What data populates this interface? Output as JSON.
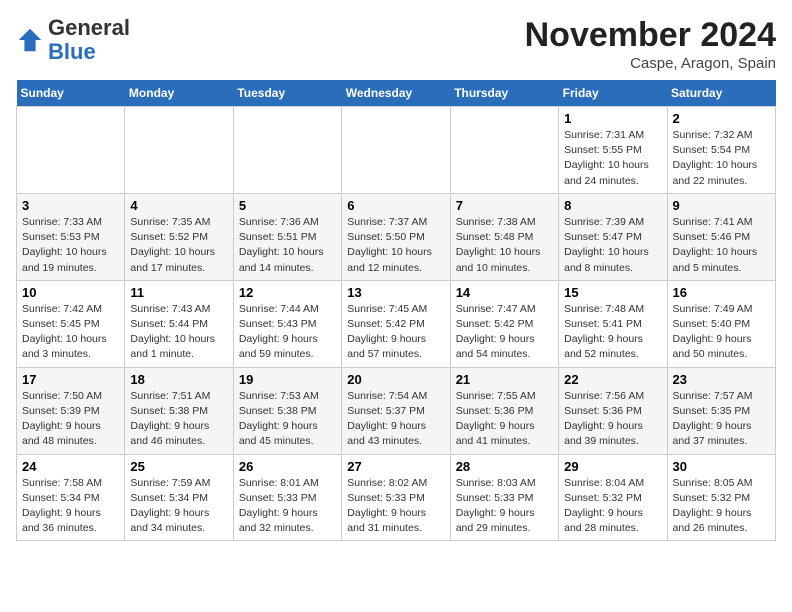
{
  "header": {
    "logo": {
      "general": "General",
      "blue": "Blue"
    },
    "title": "November 2024",
    "location": "Caspe, Aragon, Spain"
  },
  "weekdays": [
    "Sunday",
    "Monday",
    "Tuesday",
    "Wednesday",
    "Thursday",
    "Friday",
    "Saturday"
  ],
  "weeks": [
    [
      {
        "day": "",
        "info": ""
      },
      {
        "day": "",
        "info": ""
      },
      {
        "day": "",
        "info": ""
      },
      {
        "day": "",
        "info": ""
      },
      {
        "day": "",
        "info": ""
      },
      {
        "day": "1",
        "info": "Sunrise: 7:31 AM\nSunset: 5:55 PM\nDaylight: 10 hours\nand 24 minutes."
      },
      {
        "day": "2",
        "info": "Sunrise: 7:32 AM\nSunset: 5:54 PM\nDaylight: 10 hours\nand 22 minutes."
      }
    ],
    [
      {
        "day": "3",
        "info": "Sunrise: 7:33 AM\nSunset: 5:53 PM\nDaylight: 10 hours\nand 19 minutes."
      },
      {
        "day": "4",
        "info": "Sunrise: 7:35 AM\nSunset: 5:52 PM\nDaylight: 10 hours\nand 17 minutes."
      },
      {
        "day": "5",
        "info": "Sunrise: 7:36 AM\nSunset: 5:51 PM\nDaylight: 10 hours\nand 14 minutes."
      },
      {
        "day": "6",
        "info": "Sunrise: 7:37 AM\nSunset: 5:50 PM\nDaylight: 10 hours\nand 12 minutes."
      },
      {
        "day": "7",
        "info": "Sunrise: 7:38 AM\nSunset: 5:48 PM\nDaylight: 10 hours\nand 10 minutes."
      },
      {
        "day": "8",
        "info": "Sunrise: 7:39 AM\nSunset: 5:47 PM\nDaylight: 10 hours\nand 8 minutes."
      },
      {
        "day": "9",
        "info": "Sunrise: 7:41 AM\nSunset: 5:46 PM\nDaylight: 10 hours\nand 5 minutes."
      }
    ],
    [
      {
        "day": "10",
        "info": "Sunrise: 7:42 AM\nSunset: 5:45 PM\nDaylight: 10 hours\nand 3 minutes."
      },
      {
        "day": "11",
        "info": "Sunrise: 7:43 AM\nSunset: 5:44 PM\nDaylight: 10 hours\nand 1 minute."
      },
      {
        "day": "12",
        "info": "Sunrise: 7:44 AM\nSunset: 5:43 PM\nDaylight: 9 hours\nand 59 minutes."
      },
      {
        "day": "13",
        "info": "Sunrise: 7:45 AM\nSunset: 5:42 PM\nDaylight: 9 hours\nand 57 minutes."
      },
      {
        "day": "14",
        "info": "Sunrise: 7:47 AM\nSunset: 5:42 PM\nDaylight: 9 hours\nand 54 minutes."
      },
      {
        "day": "15",
        "info": "Sunrise: 7:48 AM\nSunset: 5:41 PM\nDaylight: 9 hours\nand 52 minutes."
      },
      {
        "day": "16",
        "info": "Sunrise: 7:49 AM\nSunset: 5:40 PM\nDaylight: 9 hours\nand 50 minutes."
      }
    ],
    [
      {
        "day": "17",
        "info": "Sunrise: 7:50 AM\nSunset: 5:39 PM\nDaylight: 9 hours\nand 48 minutes."
      },
      {
        "day": "18",
        "info": "Sunrise: 7:51 AM\nSunset: 5:38 PM\nDaylight: 9 hours\nand 46 minutes."
      },
      {
        "day": "19",
        "info": "Sunrise: 7:53 AM\nSunset: 5:38 PM\nDaylight: 9 hours\nand 45 minutes."
      },
      {
        "day": "20",
        "info": "Sunrise: 7:54 AM\nSunset: 5:37 PM\nDaylight: 9 hours\nand 43 minutes."
      },
      {
        "day": "21",
        "info": "Sunrise: 7:55 AM\nSunset: 5:36 PM\nDaylight: 9 hours\nand 41 minutes."
      },
      {
        "day": "22",
        "info": "Sunrise: 7:56 AM\nSunset: 5:36 PM\nDaylight: 9 hours\nand 39 minutes."
      },
      {
        "day": "23",
        "info": "Sunrise: 7:57 AM\nSunset: 5:35 PM\nDaylight: 9 hours\nand 37 minutes."
      }
    ],
    [
      {
        "day": "24",
        "info": "Sunrise: 7:58 AM\nSunset: 5:34 PM\nDaylight: 9 hours\nand 36 minutes."
      },
      {
        "day": "25",
        "info": "Sunrise: 7:59 AM\nSunset: 5:34 PM\nDaylight: 9 hours\nand 34 minutes."
      },
      {
        "day": "26",
        "info": "Sunrise: 8:01 AM\nSunset: 5:33 PM\nDaylight: 9 hours\nand 32 minutes."
      },
      {
        "day": "27",
        "info": "Sunrise: 8:02 AM\nSunset: 5:33 PM\nDaylight: 9 hours\nand 31 minutes."
      },
      {
        "day": "28",
        "info": "Sunrise: 8:03 AM\nSunset: 5:33 PM\nDaylight: 9 hours\nand 29 minutes."
      },
      {
        "day": "29",
        "info": "Sunrise: 8:04 AM\nSunset: 5:32 PM\nDaylight: 9 hours\nand 28 minutes."
      },
      {
        "day": "30",
        "info": "Sunrise: 8:05 AM\nSunset: 5:32 PM\nDaylight: 9 hours\nand 26 minutes."
      }
    ]
  ]
}
